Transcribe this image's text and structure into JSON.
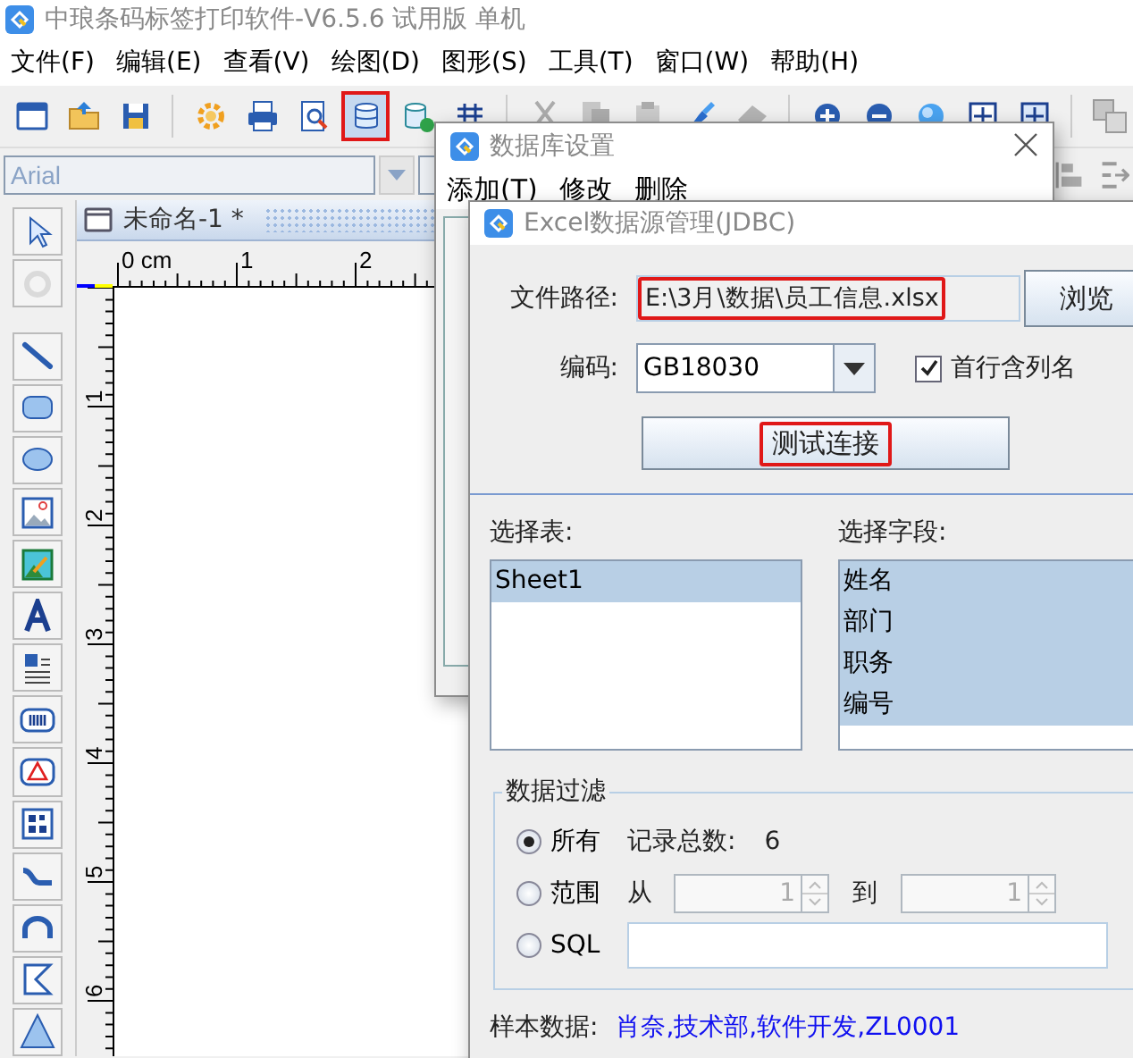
{
  "main_window": {
    "title": "中琅条码标签打印软件-V6.5.6 试用版 单机",
    "menu": [
      "文件(F)",
      "编辑(E)",
      "查看(V)",
      "绘图(D)",
      "图形(S)",
      "工具(T)",
      "窗口(W)",
      "帮助(H)"
    ],
    "toolbar": [
      {
        "kind": "new",
        "disabled": false,
        "highlighted": false
      },
      {
        "kind": "open",
        "disabled": false,
        "highlighted": false
      },
      {
        "kind": "save",
        "disabled": false,
        "highlighted": false
      },
      {
        "kind": "sep"
      },
      {
        "kind": "settings",
        "disabled": false,
        "highlighted": false
      },
      {
        "kind": "print",
        "disabled": false,
        "highlighted": false
      },
      {
        "kind": "preview",
        "disabled": false,
        "highlighted": false
      },
      {
        "kind": "database",
        "disabled": false,
        "highlighted": true
      },
      {
        "kind": "database_check",
        "disabled": false,
        "highlighted": false
      },
      {
        "kind": "grid",
        "disabled": false,
        "highlighted": false
      },
      {
        "kind": "sep"
      },
      {
        "kind": "cut",
        "disabled": true,
        "highlighted": false
      },
      {
        "kind": "copy",
        "disabled": true,
        "highlighted": false
      },
      {
        "kind": "paste",
        "disabled": true,
        "highlighted": false
      },
      {
        "kind": "brush",
        "disabled": false,
        "highlighted": false
      },
      {
        "kind": "eraser",
        "disabled": true,
        "highlighted": false
      },
      {
        "kind": "sep"
      },
      {
        "kind": "zoom_in",
        "disabled": false,
        "highlighted": false
      },
      {
        "kind": "zoom_out",
        "disabled": false,
        "highlighted": false
      },
      {
        "kind": "globe",
        "disabled": false,
        "highlighted": false
      },
      {
        "kind": "fit_page",
        "disabled": false,
        "highlighted": false
      },
      {
        "kind": "fit_width",
        "disabled": false,
        "highlighted": false
      },
      {
        "kind": "sep"
      },
      {
        "kind": "layers",
        "disabled": true,
        "highlighted": false
      }
    ],
    "font_field": {
      "value": "Arial",
      "disabled": true
    },
    "format_tools": [
      {
        "kind": "align_left",
        "disabled": true
      },
      {
        "kind": "indent",
        "disabled": true
      }
    ],
    "tools": [
      {
        "kind": "pointer",
        "disabled": false
      },
      {
        "kind": "rotate",
        "disabled": true
      },
      {
        "kind": "sep"
      },
      {
        "kind": "line",
        "disabled": false
      },
      {
        "kind": "rect",
        "disabled": false
      },
      {
        "kind": "ellipse",
        "disabled": false
      },
      {
        "kind": "image",
        "disabled": false
      },
      {
        "kind": "picture",
        "disabled": false
      },
      {
        "kind": "text",
        "disabled": false
      },
      {
        "kind": "rich_text",
        "disabled": false
      },
      {
        "kind": "barcode",
        "disabled": false
      },
      {
        "kind": "triangle",
        "disabled": false
      },
      {
        "kind": "qrcode",
        "disabled": false
      },
      {
        "kind": "curve",
        "disabled": false
      },
      {
        "kind": "arc",
        "disabled": false
      },
      {
        "kind": "polygon",
        "disabled": false
      },
      {
        "kind": "diamond",
        "disabled": false
      }
    ],
    "document_tab": {
      "title": "未命名-1 *"
    },
    "ruler": {
      "horizontal": [
        "0 cm",
        "1",
        "2"
      ],
      "vertical": [
        "1",
        "2",
        "3",
        "4",
        "5",
        "6"
      ]
    }
  },
  "database_dialog": {
    "title": "数据库设置",
    "menu": [
      "添加(T)",
      "修改",
      "删除"
    ]
  },
  "excel_dialog": {
    "title": "Excel数据源管理(JDBC)",
    "file_path": {
      "label": "文件路径:",
      "value": "E:\\3月\\数据\\员工信息.xlsx",
      "highlighted": true
    },
    "browse_button": "浏览",
    "encoding": {
      "label": "编码:",
      "value": "GB18030"
    },
    "header_row": {
      "label": "首行含列名",
      "checked": true
    },
    "test_button": {
      "label": "测试连接",
      "highlighted": true
    },
    "tables": {
      "label": "选择表:",
      "items": [
        {
          "text": "Sheet1",
          "selected": true
        }
      ]
    },
    "fields": {
      "label": "选择字段:",
      "items": [
        {
          "text": "姓名",
          "selected": true
        },
        {
          "text": "部门",
          "selected": true
        },
        {
          "text": "职务",
          "selected": true
        },
        {
          "text": "编号",
          "selected": true
        }
      ]
    },
    "filter": {
      "title": "数据过滤",
      "all": {
        "label": "所有",
        "selected": true
      },
      "count_label": "记录总数:",
      "count": "6",
      "range": {
        "label": "范围",
        "selected": false
      },
      "from_label": "从",
      "from": "1",
      "to_label": "到",
      "to": "1",
      "sql": {
        "label": "SQL",
        "selected": false
      }
    },
    "sample": {
      "label": "样本数据:",
      "value": "肖奈,技术部,软件开发,ZL0001"
    }
  }
}
